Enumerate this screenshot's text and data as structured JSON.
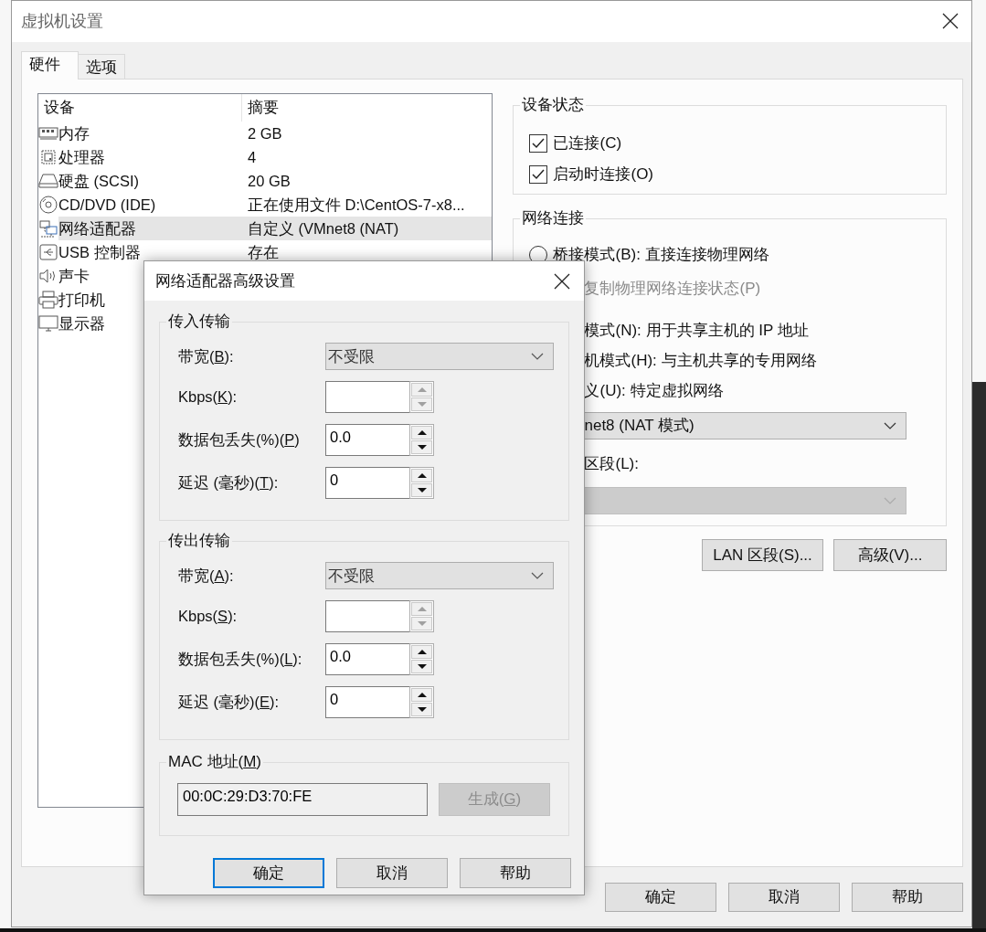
{
  "window": {
    "title": "虚拟机设置"
  },
  "tabs": [
    {
      "label": "硬件",
      "selected": true
    },
    {
      "label": "选项",
      "selected": false
    }
  ],
  "device_table": {
    "columns": [
      "设备",
      "摘要"
    ],
    "rows": [
      {
        "kind": "memory",
        "device": "内存",
        "summary": "2 GB",
        "selected": false
      },
      {
        "kind": "cpu",
        "device": "处理器",
        "summary": "4",
        "selected": false
      },
      {
        "kind": "disk",
        "device": "硬盘 (SCSI)",
        "summary": "20 GB",
        "selected": false
      },
      {
        "kind": "cd",
        "device": "CD/DVD (IDE)",
        "summary": "正在使用文件 D:\\CentOS-7-x8...",
        "selected": false
      },
      {
        "kind": "network",
        "device": "网络适配器",
        "summary": "自定义 (VMnet8 (NAT)",
        "selected": true
      },
      {
        "kind": "usb",
        "device": "USB 控制器",
        "summary": "存在",
        "selected": false
      },
      {
        "kind": "sound",
        "device": "声卡",
        "selected": false
      },
      {
        "kind": "printer",
        "device": "打印机",
        "selected": false
      },
      {
        "kind": "display",
        "device": "显示器",
        "selected": false
      }
    ]
  },
  "device_status": {
    "title": "设备状态",
    "options": [
      {
        "label": "已连接(C)",
        "checked": true
      },
      {
        "label": "启动时连接(O)",
        "checked": true
      }
    ]
  },
  "network_connection": {
    "title": "网络连接",
    "items": [
      {
        "kind": "radio",
        "label": "桥接模式(B): 直接连接物理网络",
        "selected": false
      },
      {
        "kind": "text",
        "label": "复制物理网络连接状态(P)",
        "disabled": true
      },
      {
        "kind": "text",
        "label": "模式(N): 用于共享主机的 IP 地址",
        "disabled": false
      },
      {
        "kind": "text",
        "label": "机模式(H): 与主机共享的专用网络",
        "disabled": false
      },
      {
        "kind": "text",
        "label": "义(U): 特定虚拟网络",
        "disabled": false
      },
      {
        "kind": "select",
        "value": "net8 (NAT 模式)",
        "disabled": false
      },
      {
        "kind": "text",
        "label": "区段(L):",
        "disabled": false
      },
      {
        "kind": "select",
        "disabled": true
      }
    ]
  },
  "network_buttons": [
    "LAN 区段(S)...",
    "高级(V)..."
  ],
  "buttons": [
    "确定",
    "取消",
    "帮助"
  ],
  "advanced_dialog": {
    "title": "网络适配器高级设置",
    "groups": [
      {
        "title": "传入传输",
        "rows": [
          {
            "kind": "select",
            "label": [
              "带宽(",
              "B",
              "):"
            ],
            "value": "不受限"
          },
          {
            "kind": "spin",
            "label": [
              "Kbps(",
              "K",
              "):"
            ],
            "disabled": true
          },
          {
            "kind": "spin",
            "label": [
              "数据包丢失(%)(",
              "P",
              ")"
            ],
            "value": "0.0",
            "disabled": false
          },
          {
            "kind": "spin",
            "label": [
              "延迟 (毫秒)(",
              "T",
              "):"
            ],
            "value": "0",
            "disabled": false
          }
        ]
      },
      {
        "title": "传出传输",
        "rows": [
          {
            "kind": "select",
            "label": [
              "带宽(",
              "A",
              "):"
            ],
            "value": "不受限"
          },
          {
            "kind": "spin",
            "label": [
              "Kbps(",
              "S",
              "):"
            ],
            "disabled": true
          },
          {
            "kind": "spin",
            "label": [
              "数据包丢失(%)(",
              "L",
              "):"
            ],
            "value": "0.0",
            "disabled": false
          },
          {
            "kind": "spin",
            "label": [
              "延迟 (毫秒)(",
              "E",
              "):"
            ],
            "value": "0",
            "disabled": false
          }
        ]
      }
    ],
    "mac": {
      "title": [
        "MAC 地址(",
        "M",
        ")"
      ],
      "value": "00:0C:29:D3:70:FE",
      "button": {
        "label": [
          "生成(",
          "G",
          ")"
        ],
        "disabled": true
      }
    },
    "buttons": [
      {
        "label": "确定",
        "focused": true
      },
      {
        "label": "取消",
        "focused": false
      },
      {
        "label": "帮助",
        "focused": false
      }
    ]
  }
}
